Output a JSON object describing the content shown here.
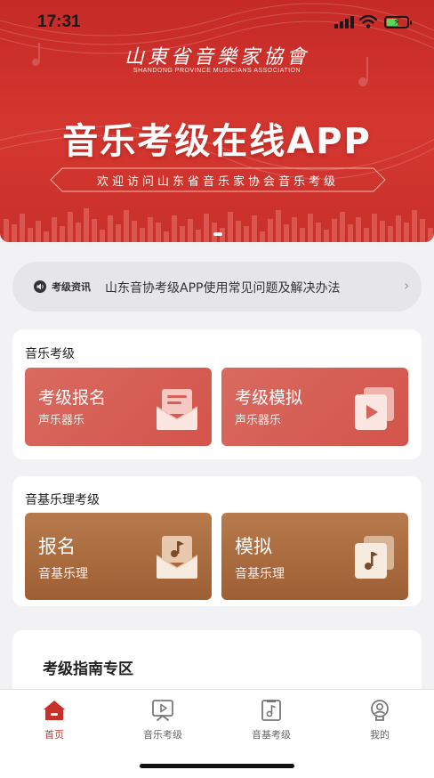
{
  "status_bar": {
    "time": "17:31"
  },
  "hero": {
    "org_name_cn": "山東省音樂家協會",
    "org_name_en": "SHANDONG PROVINCE MUSICIANS ASSOCIATION",
    "title": "音乐考级在线APP",
    "subtitle": "欢迎访问山东省音乐家协会音乐考级",
    "carousel_active_index": 0
  },
  "notice": {
    "tag": "考级资讯",
    "text": "山东音协考级APP使用常见问题及解决办法",
    "icon": "speaker-icon"
  },
  "music_exam": {
    "title": "音乐考级",
    "tiles": [
      {
        "title": "考级报名",
        "subtitle": "声乐器乐",
        "icon": "envelope-icon"
      },
      {
        "title": "考级模拟",
        "subtitle": "声乐器乐",
        "icon": "play-stack-icon"
      }
    ]
  },
  "theory_exam": {
    "title": "音基乐理考级",
    "tiles": [
      {
        "title": "报名",
        "subtitle": "音基乐理",
        "icon": "music-envelope-icon"
      },
      {
        "title": "模拟",
        "subtitle": "音基乐理",
        "icon": "music-stack-icon"
      }
    ]
  },
  "guide": {
    "title": "考级指南专区"
  },
  "tabbar": {
    "tabs": [
      {
        "label": "首页",
        "icon": "home-icon",
        "active": true
      },
      {
        "label": "音乐考级",
        "icon": "video-play-icon",
        "active": false
      },
      {
        "label": "音基考级",
        "icon": "music-doc-icon",
        "active": false
      },
      {
        "label": "我的",
        "icon": "user-icon",
        "active": false
      }
    ]
  },
  "colors": {
    "brand_red": "#c8312a",
    "tile_red": "#d65e55",
    "tile_brown": "#a8683b",
    "page_bg": "#f2f2f4"
  }
}
